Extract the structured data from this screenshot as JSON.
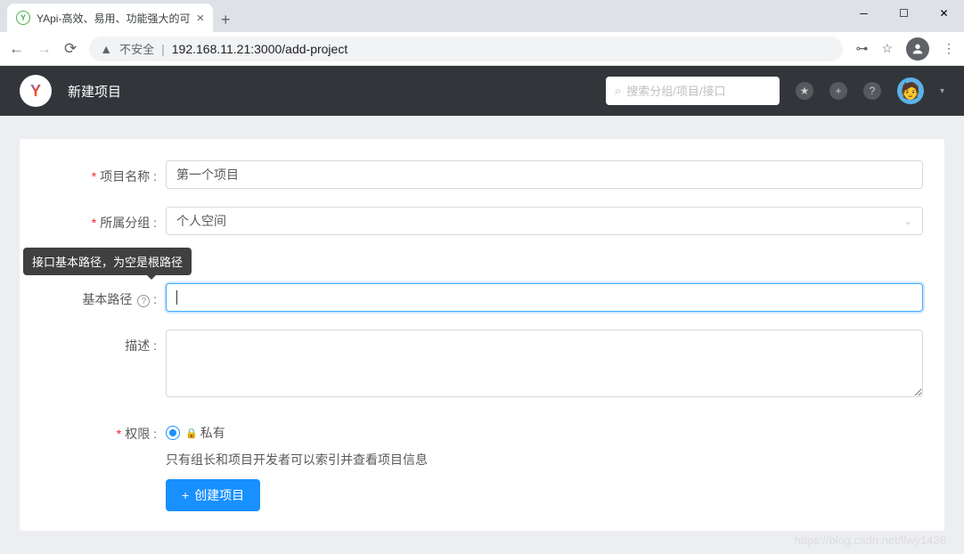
{
  "browser": {
    "tab_title": "YApi-高效、易用、功能强大的可",
    "insecure_label": "不安全",
    "url": "192.168.11.21:3000/add-project"
  },
  "header": {
    "page_title": "新建项目",
    "search_placeholder": "搜索分组/项目/接口"
  },
  "form": {
    "project_name": {
      "label": "项目名称",
      "value": "第一个项目"
    },
    "group": {
      "label": "所属分组",
      "value": "个人空间"
    },
    "base_path": {
      "label": "基本路径",
      "value": "",
      "tooltip": "接口基本路径，为空是根路径"
    },
    "description": {
      "label": "描述",
      "value": ""
    },
    "permission": {
      "label": "权限",
      "option": "私有",
      "desc": "只有组长和项目开发者可以索引并查看项目信息"
    },
    "submit": "创建项目"
  },
  "watermark": "https://blog.csdn.net/llwy1428"
}
